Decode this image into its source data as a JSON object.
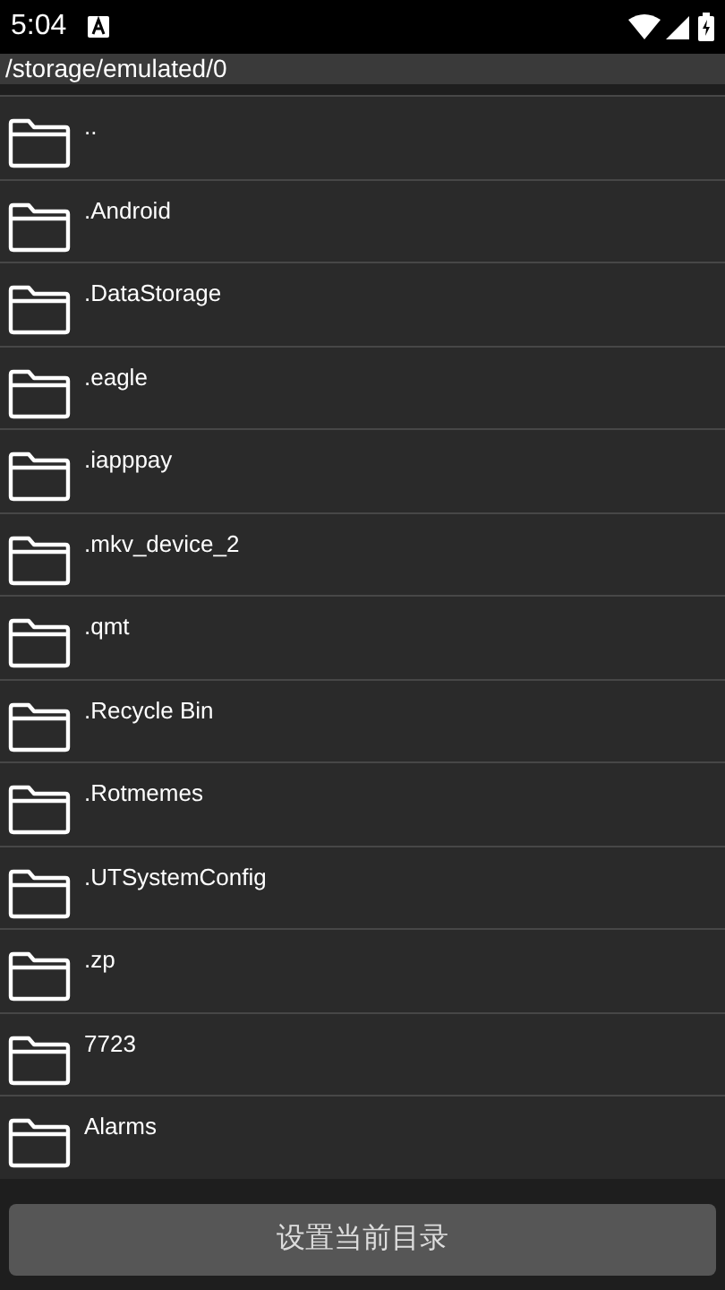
{
  "status_bar": {
    "time": "5:04"
  },
  "path": "/storage/emulated/0",
  "folders": [
    {
      "name": ".."
    },
    {
      "name": ".Android"
    },
    {
      "name": ".DataStorage"
    },
    {
      "name": ".eagle"
    },
    {
      "name": ".iapppay"
    },
    {
      "name": ".mkv_device_2"
    },
    {
      "name": ".qmt"
    },
    {
      "name": ".Recycle Bin"
    },
    {
      "name": ".Rotmemes"
    },
    {
      "name": ".UTSystemConfig"
    },
    {
      "name": ".zp"
    },
    {
      "name": "7723"
    },
    {
      "name": "Alarms"
    }
  ],
  "button": {
    "label": "设置当前目录"
  }
}
